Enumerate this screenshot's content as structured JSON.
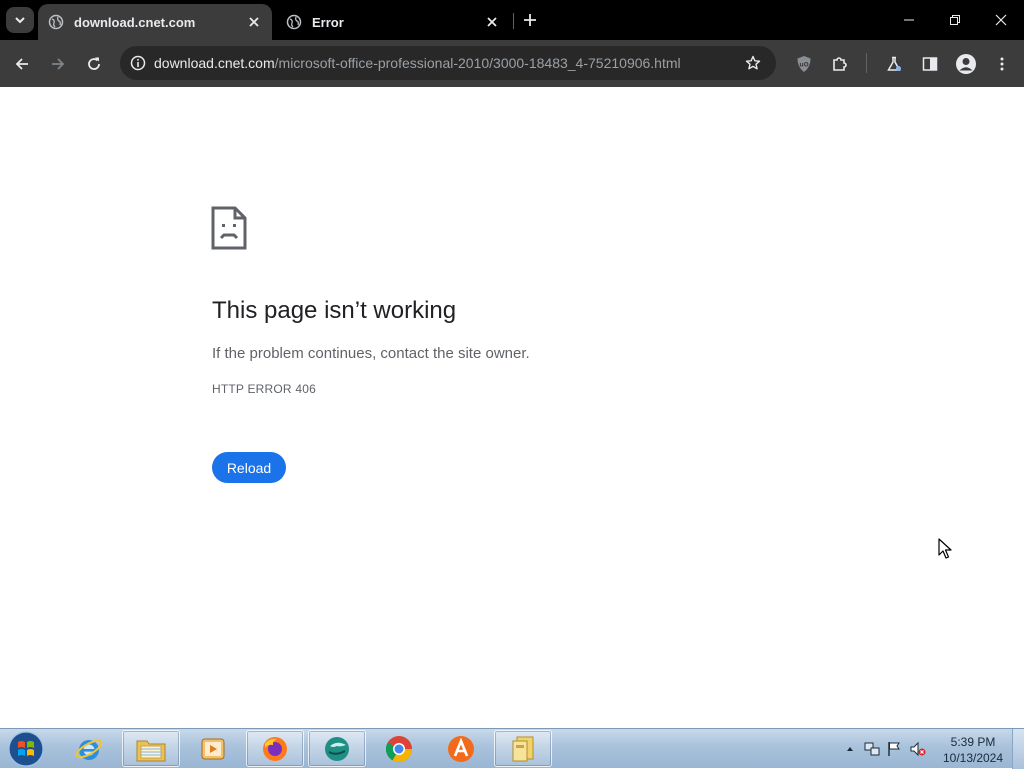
{
  "browser": {
    "tabs": [
      {
        "title": "download.cnet.com",
        "active": true
      },
      {
        "title": "Error",
        "active": false
      }
    ],
    "omnibox": {
      "host": "download.cnet.com",
      "path": "/microsoft-office-professional-2010/3000-18483_4-75210906.html"
    }
  },
  "error_page": {
    "title": "This page isn’t working",
    "description": "If the problem continues, contact the site owner.",
    "code": "HTTP ERROR 406",
    "reload_label": "Reload"
  },
  "taskbar": {
    "pinned": [
      "internet-explorer",
      "file-explorer",
      "media-player",
      "firefox",
      "app-teal",
      "chrome",
      "avast",
      "folder-app"
    ],
    "clock": {
      "time": "5:39 PM",
      "date": "10/13/2024"
    }
  },
  "colors": {
    "accent": "#1a73e8",
    "tab_active_bg": "#3c3c3c",
    "tabstrip_bg": "#000000"
  }
}
